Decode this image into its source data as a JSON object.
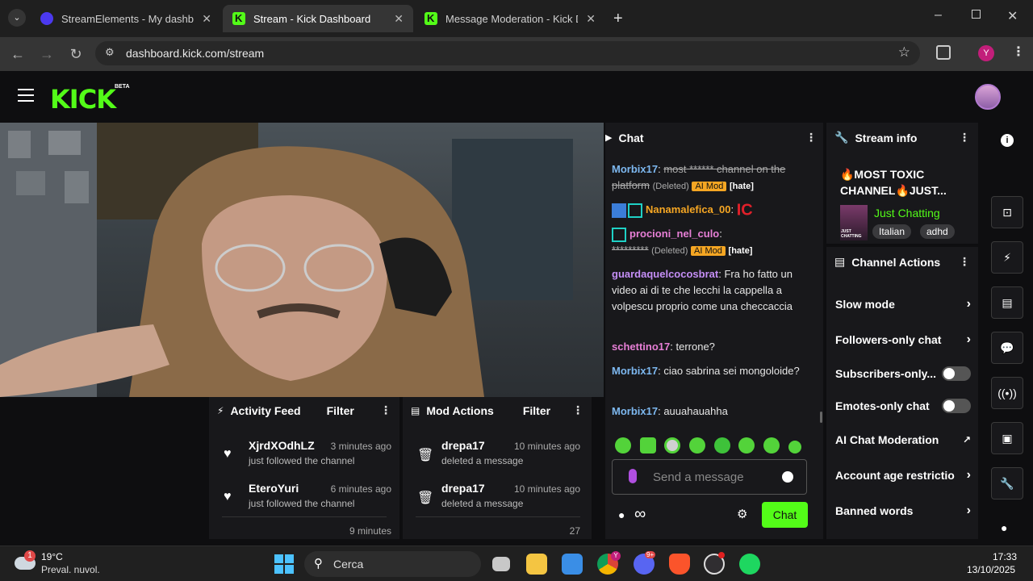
{
  "browser": {
    "tabs": [
      {
        "title": "StreamElements - My dashboard",
        "active": false
      },
      {
        "title": "Stream - Kick Dashboard",
        "active": true
      },
      {
        "title": "Message Moderation - Kick Dashboard",
        "active": false
      }
    ],
    "url": "dashboard.kick.com/stream",
    "profile_initial": "Y"
  },
  "header": {
    "logo": "KICK",
    "beta": "BETA"
  },
  "chat": {
    "title": "Chat",
    "messages": [
      {
        "user": "Morbix17",
        "text": "most ****** channel on the platform",
        "deleted_label": "(Deleted)",
        "badge": "AI Mod",
        "tag": "[hate]"
      },
      {
        "user": "Nanamalefica_00",
        "text": "IC"
      },
      {
        "user": "procioni_nel_culo",
        "text": "*********",
        "deleted_label": "(Deleted)",
        "badge": "AI Mod",
        "tag": "[hate]"
      },
      {
        "user": "guardaquelcocosbrat",
        "text": "Fra ho fatto un video ai di te che lecchi la cappella a volpescu proprio come una checcaccia"
      },
      {
        "user": "schettino17",
        "text": "terrone?"
      },
      {
        "user": "Morbix17",
        "text": "ciao sabrina sei mongoloide?"
      },
      {
        "user": "Morbix17",
        "text": "auuahauahha"
      }
    ],
    "input_placeholder": "Send a message",
    "send_label": "Chat"
  },
  "stream_info": {
    "title": "Stream info",
    "stream_title": "🔥MOST TOXIC CHANNEL🔥JUST...",
    "category": "Just Chatting",
    "thumb_text": "JUST CHATTING",
    "tags": [
      "Italian",
      "adhd"
    ]
  },
  "channel_actions": {
    "title": "Channel Actions",
    "items": [
      {
        "label": "Slow mode",
        "control": "chevron"
      },
      {
        "label": "Followers-only chat",
        "control": "chevron"
      },
      {
        "label": "Subscribers-only...",
        "control": "toggle"
      },
      {
        "label": "Emotes-only chat",
        "control": "toggle"
      },
      {
        "label": "AI Chat Moderation",
        "control": "external"
      },
      {
        "label": "Account age restrictio",
        "control": "chevron"
      },
      {
        "label": "Banned words",
        "control": "chevron"
      }
    ]
  },
  "activity_feed": {
    "title": "Activity Feed",
    "filter_label": "Filter",
    "items": [
      {
        "name": "XjrdXOdhLZ",
        "time": "3 minutes ago",
        "text": "just followed the channel"
      },
      {
        "name": "EteroYuri",
        "time": "6 minutes ago",
        "text": "just followed the channel"
      },
      {
        "name": "",
        "time": "9 minutes",
        "text": ""
      }
    ]
  },
  "mod_actions": {
    "title": "Mod Actions",
    "filter_label": "Filter",
    "items": [
      {
        "name": "drepa17",
        "time": "10 minutes ago",
        "text": "deleted a message"
      },
      {
        "name": "drepa17",
        "time": "10 minutes ago",
        "text": "deleted a message"
      },
      {
        "name": "",
        "time": "27",
        "text": ""
      }
    ]
  },
  "taskbar": {
    "weather_temp": "19°C",
    "weather_desc": "Preval. nuvol.",
    "weather_badge": "1",
    "search_label": "Cerca",
    "time": "17:33",
    "date": "13/10/2025",
    "discord_badge": "9+",
    "chrome_badge": "Y"
  },
  "colors": {
    "kick_green": "#53fc18",
    "panel": "#18181b",
    "bg": "#0e0e10",
    "ai_mod": "#f5a623"
  }
}
